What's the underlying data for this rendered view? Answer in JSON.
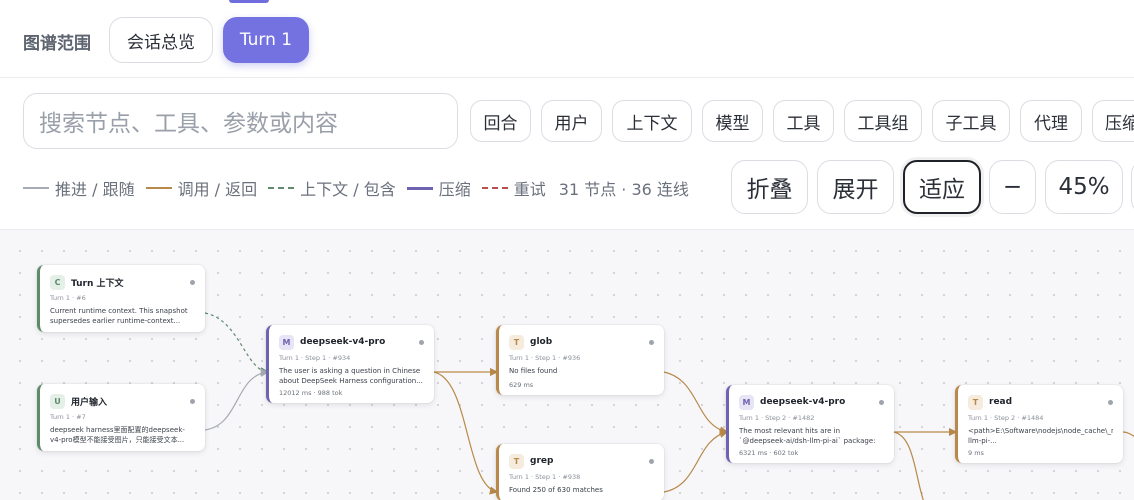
{
  "scope": {
    "label": "图谱范围",
    "overview_button": "会话总览",
    "turn_button": "Turn 1"
  },
  "search": {
    "placeholder": "搜索节点、工具、参数或内容"
  },
  "filters": [
    "回合",
    "用户",
    "上下文",
    "模型",
    "工具",
    "工具组",
    "子工具",
    "代理",
    "压缩"
  ],
  "legend": {
    "items": [
      {
        "label": "推进 / 跟随",
        "color": "#a5aab3",
        "style": "solid"
      },
      {
        "label": "调用 / 返回",
        "color": "#b8894a",
        "style": "solid"
      },
      {
        "label": "上下文 / 包含",
        "color": "#5f8a6c",
        "style": "dashed"
      },
      {
        "label": "压缩",
        "color": "#6e63b0",
        "style": "solid"
      },
      {
        "label": "重试",
        "color": "#b85050",
        "style": "dashed"
      }
    ],
    "stats": "31 节点 · 36 连线"
  },
  "controls": {
    "collapse": "折叠",
    "expand": "展开",
    "fit": "适应",
    "zoom_out": "−",
    "zoom_level": "45%"
  },
  "colors": {
    "accent": "#7472e0",
    "context": "#5f8a6c",
    "model": "#6e63b0",
    "tool": "#b8894a"
  },
  "nodes": [
    {
      "id": "ctx",
      "badge": "C",
      "kind": "context",
      "title": "Turn 上下文",
      "meta": "Turn 1 · #6",
      "desc": "Current runtime context. This snapshot supersedes earlier runtime-context...",
      "stats": ""
    },
    {
      "id": "user",
      "badge": "U",
      "kind": "context",
      "title": "用户输入",
      "meta": "Turn 1 · #7",
      "desc": "deepseek harness里面配置的deepseek-v4-pro模型不能接受图片，只能接受文本...",
      "stats": ""
    },
    {
      "id": "m1",
      "badge": "M",
      "kind": "model",
      "title": "deepseek-v4-pro",
      "meta": "Turn 1 · Step 1 · #934",
      "desc": "The user is asking a question in Chinese about DeepSeek Harness configuration...",
      "stats": "12012 ms · 988 tok"
    },
    {
      "id": "glob",
      "badge": "T",
      "kind": "tool",
      "title": "glob",
      "meta": "Turn 1 · Step 1 · #936",
      "desc": "No files found",
      "stats": "629 ms"
    },
    {
      "id": "grep",
      "badge": "T",
      "kind": "tool",
      "title": "grep",
      "meta": "Turn 1 · Step 1 · #938",
      "desc": "Found 250 of 630 matches",
      "stats": ""
    },
    {
      "id": "m2",
      "badge": "M",
      "kind": "model",
      "title": "deepseek-v4-pro",
      "meta": "Turn 1 · Step 2 · #1482",
      "desc": "The most relevant hits are in `@deepseek-ai/dsh-llm-pi-ai` package: ...",
      "stats": "6321 ms · 602 tok"
    },
    {
      "id": "read",
      "badge": "T",
      "kind": "tool",
      "title": "read",
      "meta": "Turn 1 · Step 2 · #1484",
      "desc": "<path>E:\\Software\\nodejs\\node_cache\\_npx\\...\\dsh-llm-pi-...",
      "stats": "9 ms"
    }
  ]
}
